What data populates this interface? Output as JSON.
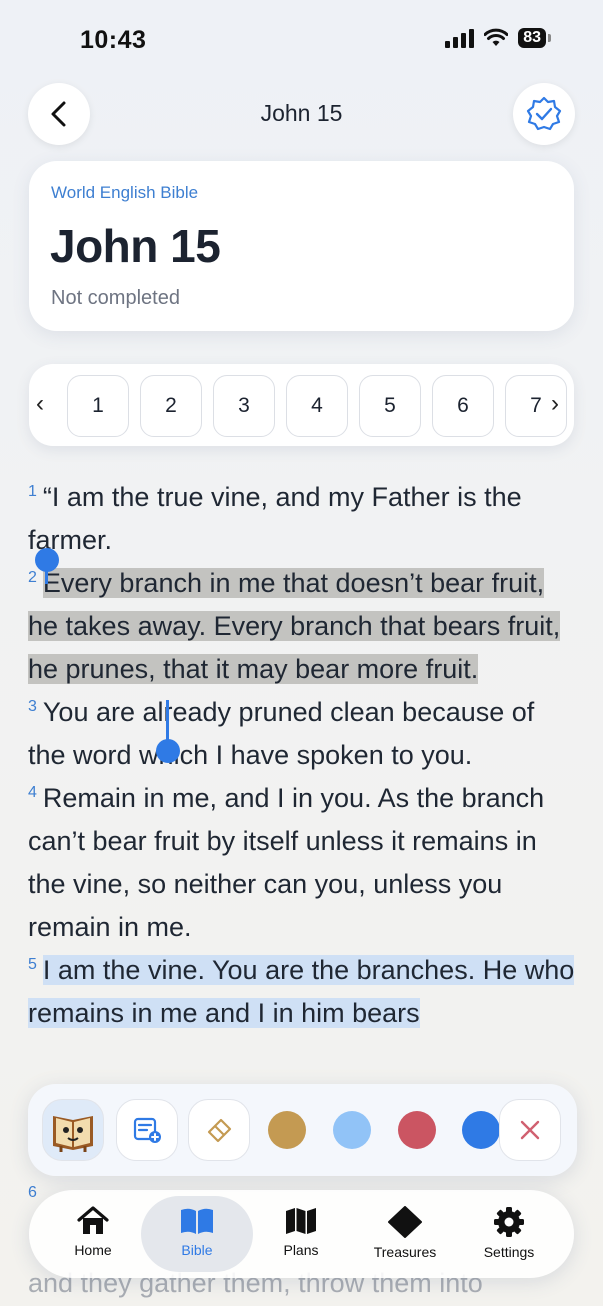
{
  "status_bar": {
    "time": "10:43",
    "battery": "83"
  },
  "header": {
    "title": "John 15"
  },
  "chapter_card": {
    "translation": "World English Bible",
    "title": "John 15",
    "status": "Not completed"
  },
  "chapter_selector": {
    "chapters": [
      "1",
      "2",
      "3",
      "4",
      "5",
      "6",
      "7"
    ]
  },
  "verses": [
    {
      "num": "1",
      "text": "“I am the true vine, and my Father is the farmer."
    },
    {
      "num": "2",
      "text": "Every branch in me that doesn’t bear fruit, he takes away. Every branch that bears fruit, he prunes, that it may bear more fruit."
    },
    {
      "num": "3",
      "text": "You are already pruned clean because of the word which I have spoken to you."
    },
    {
      "num": "4",
      "text": "Remain in me, and I in you. As the branch can’t bear fruit by itself unless it remains in the vine, so neither can you, unless you remain in me."
    },
    {
      "num": "5",
      "text": "I am the vine. You are the branches. He who remains in me and I in him bears"
    },
    {
      "num": "6",
      "text": ""
    }
  ],
  "faded_text": "and they gather them, throw them into",
  "highlight_toolbar": {
    "colors": [
      "#c49a52",
      "#91c3f7",
      "#cb5562",
      "#2f7ae5"
    ],
    "close_color": "#d06070"
  },
  "bottom_nav": {
    "items": [
      {
        "label": "Home",
        "icon": "home-icon"
      },
      {
        "label": "Bible",
        "icon": "book-icon"
      },
      {
        "label": "Plans",
        "icon": "map-icon"
      },
      {
        "label": "Treasures",
        "icon": "diamond-icon"
      },
      {
        "label": "Settings",
        "icon": "gear-icon"
      }
    ],
    "active": "Bible"
  }
}
